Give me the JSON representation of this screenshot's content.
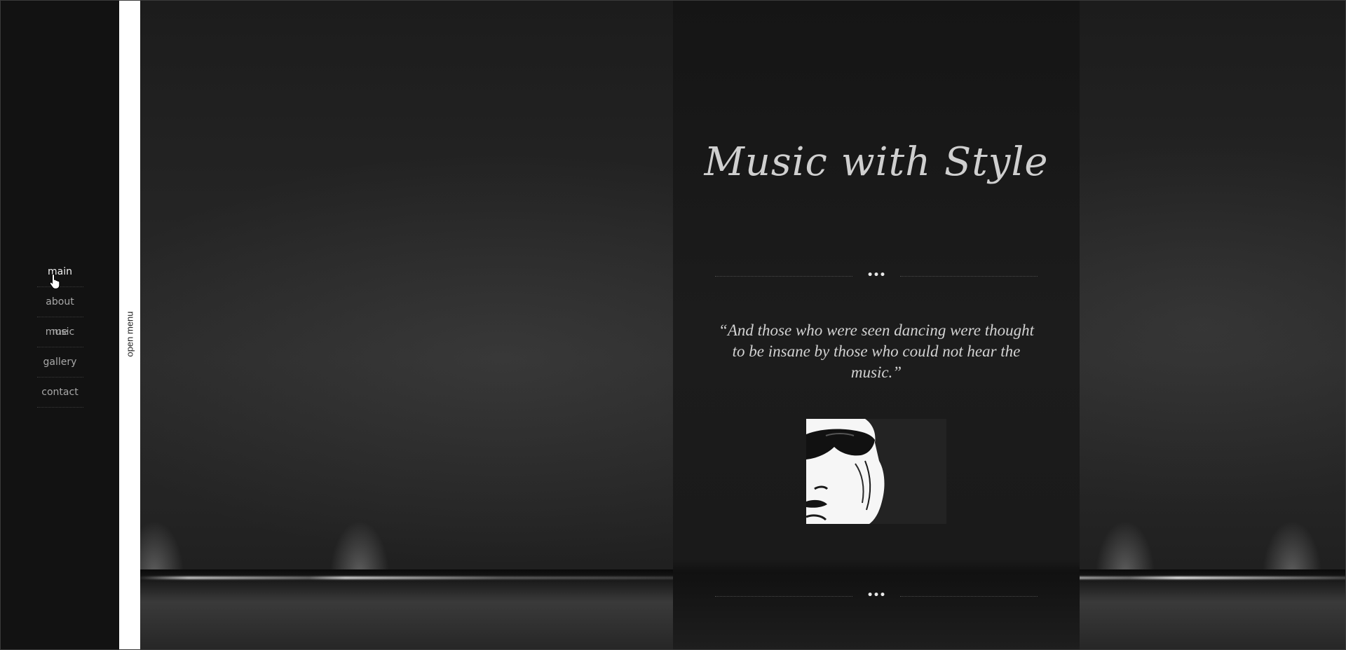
{
  "sidebar": {
    "items": [
      {
        "label": "main"
      },
      {
        "label": "about me"
      },
      {
        "label": "music"
      },
      {
        "label": "gallery"
      },
      {
        "label": "contact"
      }
    ],
    "active_item": "main"
  },
  "menu_strip": {
    "label": "open menu"
  },
  "hero": {
    "title": "Music with Style",
    "divider_dots": "•••",
    "quote": "“And those who were seen dancing were thought to be insane by those who could not hear the music.”",
    "portrait_icon": "sunglasses-portrait-image"
  },
  "colors": {
    "sidebar_bg": "#121212",
    "menu_strip_bg": "#ffffff",
    "stage_bg": "#262626",
    "center_column_bg": "#1a1a1a",
    "title_color": "#cfcfcf",
    "nav_text": "#a8a8a8",
    "nav_active_text": "#f2f2f2"
  }
}
